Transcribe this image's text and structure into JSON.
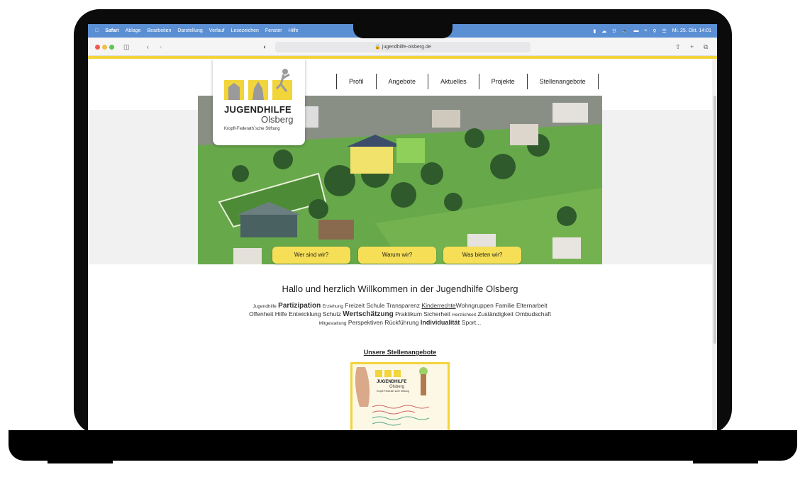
{
  "menubar": {
    "app": "Safari",
    "items": [
      "Ablage",
      "Bearbeiten",
      "Darstellung",
      "Verlauf",
      "Lesezeichen",
      "Fenster",
      "Hilfe"
    ],
    "datetime": "Mi. 25. Okt. 14:01"
  },
  "browser": {
    "url": "jugendhilfe-olsberg.de"
  },
  "nav": {
    "items": [
      "Profil",
      "Angebote",
      "Aktuelles",
      "Projekte",
      "Stellenangebote"
    ]
  },
  "logo": {
    "title": "JUGENDHILFE",
    "subtitle": "Olsberg",
    "foundation": "Kropff-Federath´sche Stiftung"
  },
  "hero": {
    "buttons": [
      "Wer sind wir?",
      "Warum wir?",
      "Was bieten wir?"
    ]
  },
  "welcome": "Hallo und herzlich Willkommen in der Jugendhilfe Olsberg",
  "tagcloud": {
    "line1": [
      {
        "t": "Jugendhilfe",
        "s": "small"
      },
      {
        "t": "Partizipation",
        "s": "big"
      },
      {
        "t": "Erziehung",
        "s": "small"
      },
      {
        "t": "Freizeit Schule Transparenz",
        "s": "normal"
      },
      {
        "t": "Kinderrechte",
        "s": "ul"
      },
      {
        "t": "Wohngruppen Familie Elternarbeit",
        "s": "normal"
      }
    ],
    "line2": [
      {
        "t": "Offenheit Hilfe Entwicklung Schutz",
        "s": "normal"
      },
      {
        "t": "Wertschätzung",
        "s": "big"
      },
      {
        "t": "Praktikum Sicherheit",
        "s": "normal"
      },
      {
        "t": "Herzlichkeit",
        "s": "small"
      },
      {
        "t": "Zuständigkeit Ombudschaft",
        "s": "normal"
      }
    ],
    "line3": [
      {
        "t": "Mitgestaltung",
        "s": "small"
      },
      {
        "t": "Perspektiven Rückführung",
        "s": "normal"
      },
      {
        "t": "Individualität",
        "s": "big"
      },
      {
        "t": "Sport...",
        "s": "normal"
      }
    ]
  },
  "jobs": {
    "title": "Unsere Stellenangebote",
    "card_title": "JUGENDHILFE",
    "card_subtitle": "Olsberg",
    "card_small": "Kropff-Federath´sche Stiftung"
  },
  "colors": {
    "accent_yellow": "#f2d43b",
    "button_yellow": "#f6df57",
    "menubar_blue": "#5b8fd4"
  }
}
